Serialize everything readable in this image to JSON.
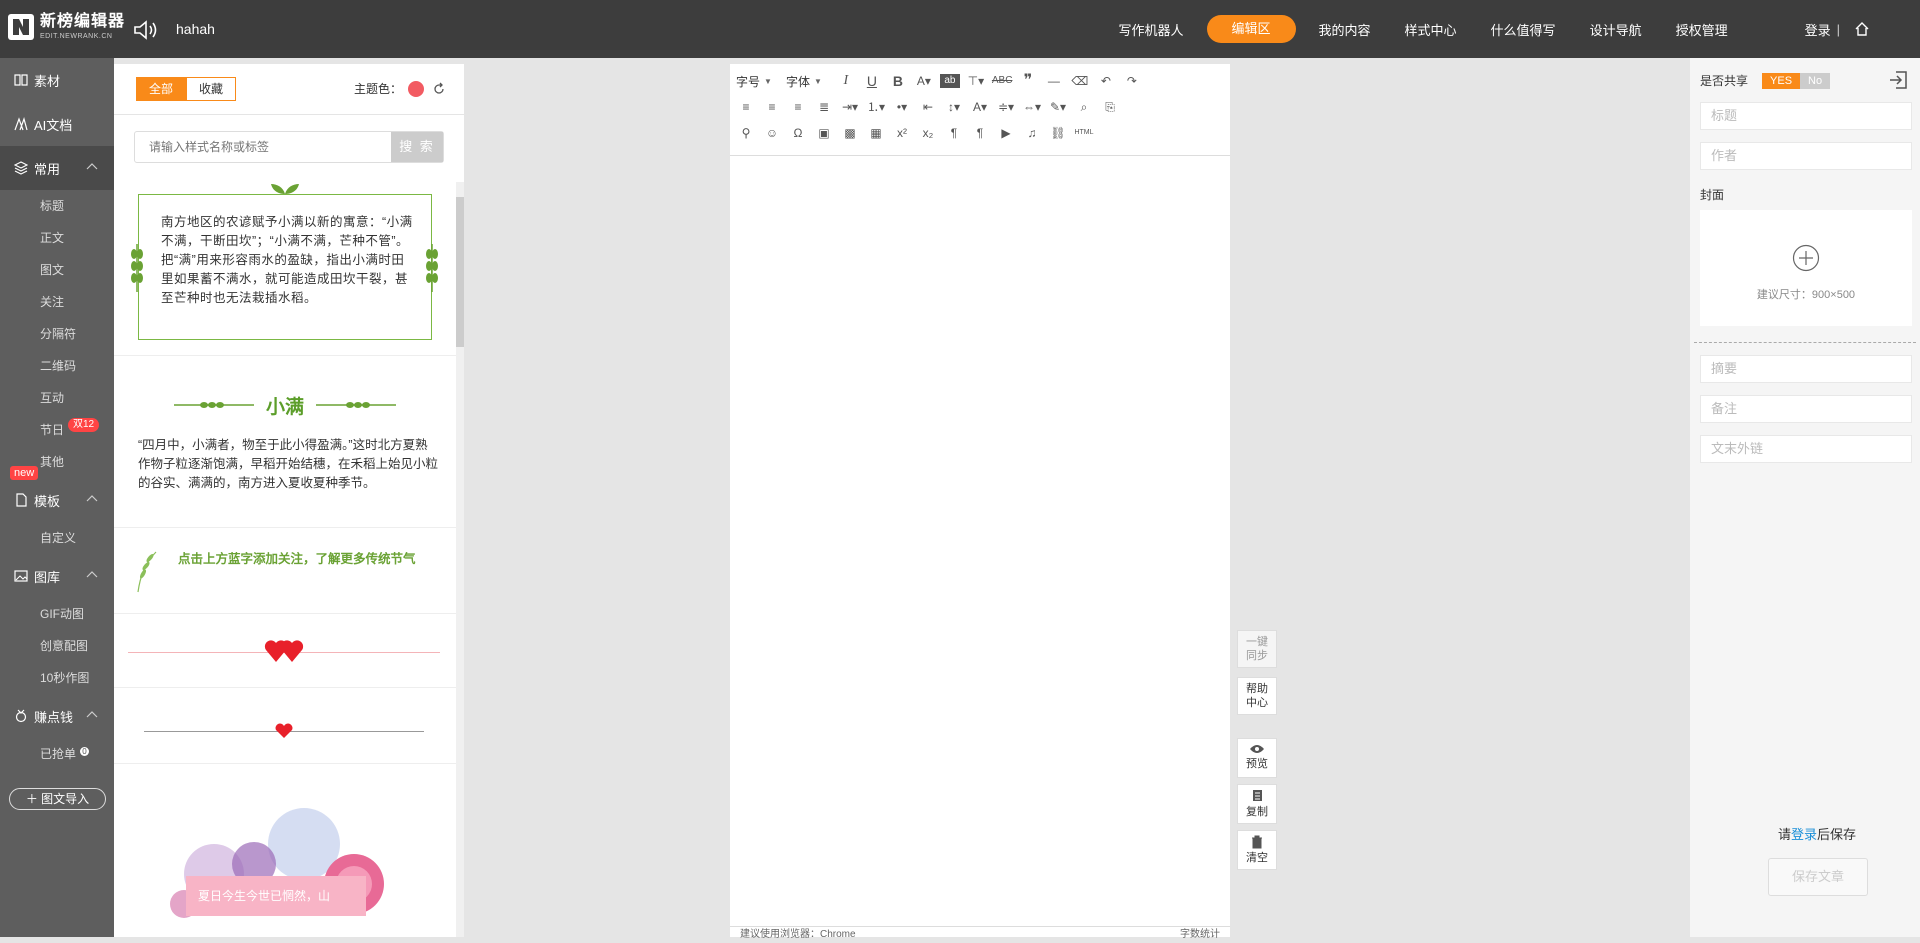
{
  "app": {
    "title": "新榜编辑器",
    "subtitle": "EDIT.NEWRANK.CN",
    "username": "hahah"
  },
  "nav": {
    "items": [
      "写作机器人",
      "编辑区",
      "我的内容",
      "样式中心",
      "什么值得写",
      "设计导航",
      "授权管理"
    ],
    "active": "编辑区",
    "login": "登录",
    "separator": "|"
  },
  "leftnav": {
    "main": [
      {
        "label": "素材",
        "icon": "book-icon"
      },
      {
        "label": "AI文档",
        "icon": "ai-icon"
      },
      {
        "label": "常用",
        "icon": "layers-icon"
      }
    ],
    "common_sub": [
      "标题",
      "正文",
      "图文",
      "关注",
      "分隔符",
      "二维码",
      "互动",
      "节日",
      "其他"
    ],
    "festival_badge": "双12",
    "template": {
      "label": "模板",
      "badge": "new",
      "sub": [
        "自定义"
      ]
    },
    "gallery": {
      "label": "图库",
      "sub": [
        "GIF动图",
        "创意配图",
        "10秒作图"
      ]
    },
    "earn": {
      "label": "赚点钱",
      "sub": [
        "已抢单"
      ],
      "badge_count": "0"
    },
    "import_btn": "图文导入"
  },
  "stylepanel": {
    "tabs": [
      "全部",
      "收藏"
    ],
    "theme_label": "主题色：",
    "theme_color": "#f25b62",
    "search_placeholder": "请输入样式名称或标签",
    "search_btn": "搜 索",
    "cards": [
      {
        "text": "南方地区的农谚赋予小满以新的寓意：“小满不满，干断田坎”；“小满不满，芒种不管”。把“满”用来形容雨水的盈缺，指出小满时田里如果蓄不满水，就可能造成田坎干裂，甚至芒种时也无法栽插水稻。"
      },
      {
        "title": "小满",
        "text": "“四月中，小满者，物至于此小得盈满。”这时北方夏熟作物子粒逐渐饱满，早稻开始结穗，在禾稻上始见小粒的谷实、满满的，南方进入夏收夏种季节。"
      },
      {
        "text": "点击上方蓝字添加关注，了解更多传统节气"
      },
      {
        "type": "heart-divider-1"
      },
      {
        "type": "heart-divider-2"
      },
      {
        "banner": "夏日今生今世已惘然，山"
      }
    ]
  },
  "editor": {
    "toolbar_row1": [
      "字号",
      "字体"
    ],
    "footer_left": "建议使用浏览器：Chrome",
    "footer_right": "字数统计"
  },
  "sidebuttons": {
    "sync": "一键同步",
    "help": "帮助中心",
    "preview": "预览",
    "copy": "复制",
    "clear": "清空"
  },
  "rightpanel": {
    "share_label": "是否共享",
    "yes": "YES",
    "no": "No",
    "title_placeholder": "标题",
    "author_placeholder": "作者",
    "cover_label": "封面",
    "cover_hint": "建议尺寸：900×500",
    "summary_placeholder": "摘要",
    "note_placeholder": "备注",
    "link_placeholder": "文末外链",
    "login_prefix": "请",
    "login_link": "登录",
    "login_suffix": "后保存",
    "save_btn": "保存文章"
  },
  "colors": {
    "accent": "#f98a19",
    "topbar": "#3d3d3d",
    "leftnav": "#5e5e5e",
    "green": "#7bb843",
    "heart": "#e8202a"
  }
}
